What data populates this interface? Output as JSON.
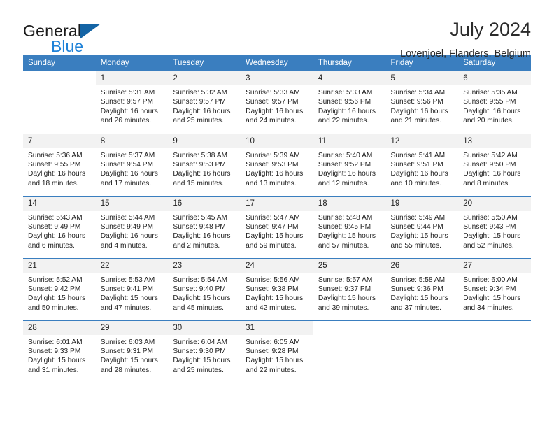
{
  "brand": {
    "name_part1": "General",
    "name_part2": "Blue",
    "flag_icon": "triangle-flag-icon",
    "accent_dark": "#1464a5",
    "accent_light": "#1f82d8"
  },
  "header": {
    "title": "July 2024",
    "location": "Lovenjoel, Flanders, Belgium"
  },
  "calendar": {
    "header_bg": "#3a7ebf",
    "daynum_bg": "#f2f2f2",
    "weekday_headers": [
      "Sunday",
      "Monday",
      "Tuesday",
      "Wednesday",
      "Thursday",
      "Friday",
      "Saturday"
    ],
    "weeks": [
      [
        {
          "day": "",
          "sunrise": "",
          "sunset": "",
          "daylight_line1": "",
          "daylight_line2": ""
        },
        {
          "day": "1",
          "sunrise": "Sunrise: 5:31 AM",
          "sunset": "Sunset: 9:57 PM",
          "daylight_line1": "Daylight: 16 hours",
          "daylight_line2": "and 26 minutes."
        },
        {
          "day": "2",
          "sunrise": "Sunrise: 5:32 AM",
          "sunset": "Sunset: 9:57 PM",
          "daylight_line1": "Daylight: 16 hours",
          "daylight_line2": "and 25 minutes."
        },
        {
          "day": "3",
          "sunrise": "Sunrise: 5:33 AM",
          "sunset": "Sunset: 9:57 PM",
          "daylight_line1": "Daylight: 16 hours",
          "daylight_line2": "and 24 minutes."
        },
        {
          "day": "4",
          "sunrise": "Sunrise: 5:33 AM",
          "sunset": "Sunset: 9:56 PM",
          "daylight_line1": "Daylight: 16 hours",
          "daylight_line2": "and 22 minutes."
        },
        {
          "day": "5",
          "sunrise": "Sunrise: 5:34 AM",
          "sunset": "Sunset: 9:56 PM",
          "daylight_line1": "Daylight: 16 hours",
          "daylight_line2": "and 21 minutes."
        },
        {
          "day": "6",
          "sunrise": "Sunrise: 5:35 AM",
          "sunset": "Sunset: 9:55 PM",
          "daylight_line1": "Daylight: 16 hours",
          "daylight_line2": "and 20 minutes."
        }
      ],
      [
        {
          "day": "7",
          "sunrise": "Sunrise: 5:36 AM",
          "sunset": "Sunset: 9:55 PM",
          "daylight_line1": "Daylight: 16 hours",
          "daylight_line2": "and 18 minutes."
        },
        {
          "day": "8",
          "sunrise": "Sunrise: 5:37 AM",
          "sunset": "Sunset: 9:54 PM",
          "daylight_line1": "Daylight: 16 hours",
          "daylight_line2": "and 17 minutes."
        },
        {
          "day": "9",
          "sunrise": "Sunrise: 5:38 AM",
          "sunset": "Sunset: 9:53 PM",
          "daylight_line1": "Daylight: 16 hours",
          "daylight_line2": "and 15 minutes."
        },
        {
          "day": "10",
          "sunrise": "Sunrise: 5:39 AM",
          "sunset": "Sunset: 9:53 PM",
          "daylight_line1": "Daylight: 16 hours",
          "daylight_line2": "and 13 minutes."
        },
        {
          "day": "11",
          "sunrise": "Sunrise: 5:40 AM",
          "sunset": "Sunset: 9:52 PM",
          "daylight_line1": "Daylight: 16 hours",
          "daylight_line2": "and 12 minutes."
        },
        {
          "day": "12",
          "sunrise": "Sunrise: 5:41 AM",
          "sunset": "Sunset: 9:51 PM",
          "daylight_line1": "Daylight: 16 hours",
          "daylight_line2": "and 10 minutes."
        },
        {
          "day": "13",
          "sunrise": "Sunrise: 5:42 AM",
          "sunset": "Sunset: 9:50 PM",
          "daylight_line1": "Daylight: 16 hours",
          "daylight_line2": "and 8 minutes."
        }
      ],
      [
        {
          "day": "14",
          "sunrise": "Sunrise: 5:43 AM",
          "sunset": "Sunset: 9:49 PM",
          "daylight_line1": "Daylight: 16 hours",
          "daylight_line2": "and 6 minutes."
        },
        {
          "day": "15",
          "sunrise": "Sunrise: 5:44 AM",
          "sunset": "Sunset: 9:49 PM",
          "daylight_line1": "Daylight: 16 hours",
          "daylight_line2": "and 4 minutes."
        },
        {
          "day": "16",
          "sunrise": "Sunrise: 5:45 AM",
          "sunset": "Sunset: 9:48 PM",
          "daylight_line1": "Daylight: 16 hours",
          "daylight_line2": "and 2 minutes."
        },
        {
          "day": "17",
          "sunrise": "Sunrise: 5:47 AM",
          "sunset": "Sunset: 9:47 PM",
          "daylight_line1": "Daylight: 15 hours",
          "daylight_line2": "and 59 minutes."
        },
        {
          "day": "18",
          "sunrise": "Sunrise: 5:48 AM",
          "sunset": "Sunset: 9:45 PM",
          "daylight_line1": "Daylight: 15 hours",
          "daylight_line2": "and 57 minutes."
        },
        {
          "day": "19",
          "sunrise": "Sunrise: 5:49 AM",
          "sunset": "Sunset: 9:44 PM",
          "daylight_line1": "Daylight: 15 hours",
          "daylight_line2": "and 55 minutes."
        },
        {
          "day": "20",
          "sunrise": "Sunrise: 5:50 AM",
          "sunset": "Sunset: 9:43 PM",
          "daylight_line1": "Daylight: 15 hours",
          "daylight_line2": "and 52 minutes."
        }
      ],
      [
        {
          "day": "21",
          "sunrise": "Sunrise: 5:52 AM",
          "sunset": "Sunset: 9:42 PM",
          "daylight_line1": "Daylight: 15 hours",
          "daylight_line2": "and 50 minutes."
        },
        {
          "day": "22",
          "sunrise": "Sunrise: 5:53 AM",
          "sunset": "Sunset: 9:41 PM",
          "daylight_line1": "Daylight: 15 hours",
          "daylight_line2": "and 47 minutes."
        },
        {
          "day": "23",
          "sunrise": "Sunrise: 5:54 AM",
          "sunset": "Sunset: 9:40 PM",
          "daylight_line1": "Daylight: 15 hours",
          "daylight_line2": "and 45 minutes."
        },
        {
          "day": "24",
          "sunrise": "Sunrise: 5:56 AM",
          "sunset": "Sunset: 9:38 PM",
          "daylight_line1": "Daylight: 15 hours",
          "daylight_line2": "and 42 minutes."
        },
        {
          "day": "25",
          "sunrise": "Sunrise: 5:57 AM",
          "sunset": "Sunset: 9:37 PM",
          "daylight_line1": "Daylight: 15 hours",
          "daylight_line2": "and 39 minutes."
        },
        {
          "day": "26",
          "sunrise": "Sunrise: 5:58 AM",
          "sunset": "Sunset: 9:36 PM",
          "daylight_line1": "Daylight: 15 hours",
          "daylight_line2": "and 37 minutes."
        },
        {
          "day": "27",
          "sunrise": "Sunrise: 6:00 AM",
          "sunset": "Sunset: 9:34 PM",
          "daylight_line1": "Daylight: 15 hours",
          "daylight_line2": "and 34 minutes."
        }
      ],
      [
        {
          "day": "28",
          "sunrise": "Sunrise: 6:01 AM",
          "sunset": "Sunset: 9:33 PM",
          "daylight_line1": "Daylight: 15 hours",
          "daylight_line2": "and 31 minutes."
        },
        {
          "day": "29",
          "sunrise": "Sunrise: 6:03 AM",
          "sunset": "Sunset: 9:31 PM",
          "daylight_line1": "Daylight: 15 hours",
          "daylight_line2": "and 28 minutes."
        },
        {
          "day": "30",
          "sunrise": "Sunrise: 6:04 AM",
          "sunset": "Sunset: 9:30 PM",
          "daylight_line1": "Daylight: 15 hours",
          "daylight_line2": "and 25 minutes."
        },
        {
          "day": "31",
          "sunrise": "Sunrise: 6:05 AM",
          "sunset": "Sunset: 9:28 PM",
          "daylight_line1": "Daylight: 15 hours",
          "daylight_line2": "and 22 minutes."
        },
        {
          "day": "",
          "sunrise": "",
          "sunset": "",
          "daylight_line1": "",
          "daylight_line2": ""
        },
        {
          "day": "",
          "sunrise": "",
          "sunset": "",
          "daylight_line1": "",
          "daylight_line2": ""
        },
        {
          "day": "",
          "sunrise": "",
          "sunset": "",
          "daylight_line1": "",
          "daylight_line2": ""
        }
      ]
    ]
  }
}
